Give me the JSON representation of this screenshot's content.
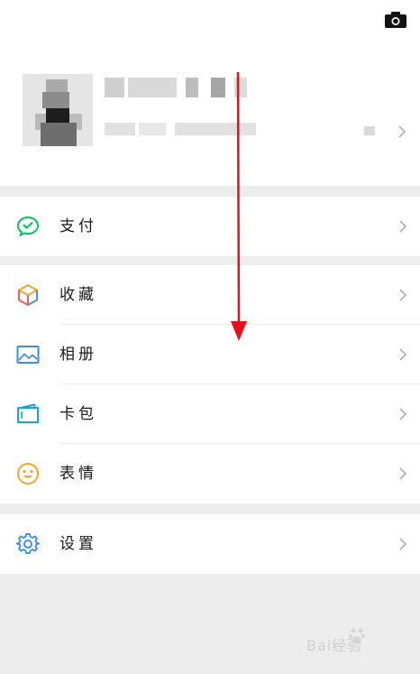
{
  "menu": {
    "pay": {
      "label": "支付",
      "icon": "wechat-pay-icon"
    },
    "favorites": {
      "label": "收藏",
      "icon": "favorites-cube-icon"
    },
    "album": {
      "label": "相册",
      "icon": "album-picture-icon"
    },
    "cards": {
      "label": "卡包",
      "icon": "card-wallet-icon"
    },
    "stickers": {
      "label": "表情",
      "icon": "sticker-smiley-icon"
    },
    "settings": {
      "label": "设置",
      "icon": "settings-gear-icon"
    }
  },
  "colors": {
    "pay_green": "#07c160",
    "favorites_orange": "#f5a623",
    "favorites_red": "#f05e5e",
    "favorites_blue": "#4a90e2",
    "album_blue": "#3a8ee6",
    "cards_blue": "#1aa3d9",
    "sticker_orange": "#f5a623",
    "settings_blue": "#2b8be6",
    "annotation_arrow": "#e8101b"
  },
  "watermark": {
    "text": "Bai经验"
  }
}
